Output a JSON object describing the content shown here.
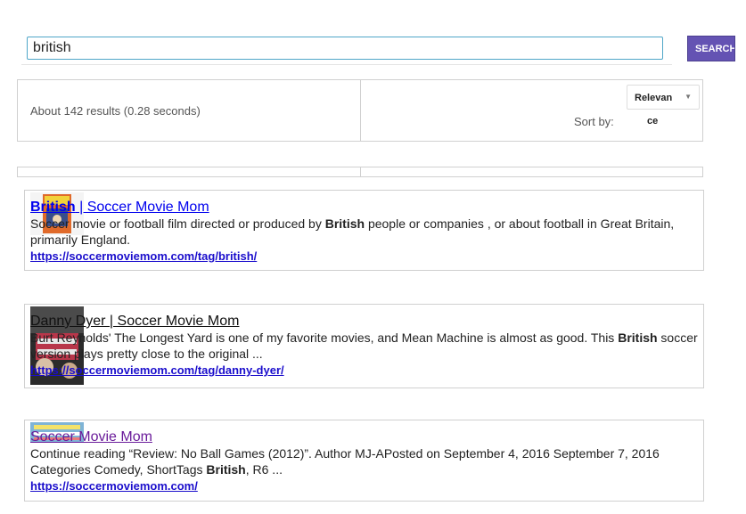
{
  "search": {
    "value": "british",
    "button_label": "SEARCH"
  },
  "summary": {
    "count_text": "About 142 results (0.28 seconds)",
    "sort_label": "Sort by:",
    "sort_value_top": "Relevan",
    "sort_value_rest": "ce"
  },
  "results": [
    {
      "title_highlight": "British",
      "title_rest": " | Soccer Movie Mom",
      "snippet_parts": [
        "Soccer movie or football film directed or produced by ",
        "British",
        " people or companies , or about football in Great Britain, primarily England."
      ],
      "url": "https://soccermoviemom.com/tag/british/"
    },
    {
      "title": "Danny Dyer | Soccer Movie Mom",
      "snippet_parts": [
        "Burt Reynolds' The Longest Yard is one of my favorite movies, and Mean Machine is almost as good. This ",
        "British",
        " soccer version plays pretty close to the original ..."
      ],
      "url": "https://soccermoviemom.com/tag/danny-dyer/"
    },
    {
      "title": "Soccer Movie Mom",
      "snippet_parts": [
        "Continue reading “Review: No Ball Games (2012)”. Author MJ-APosted on September 4, 2016 September 7, 2016 Categories Comedy, ShortTags ",
        "British",
        ", R6 ..."
      ],
      "url": "https://soccermoviemom.com/"
    }
  ],
  "colors": {
    "search_button": "#6453b3",
    "link_blue": "#0000ee",
    "url_blue": "#1a0dcc",
    "input_border": "#4fa6c8"
  }
}
